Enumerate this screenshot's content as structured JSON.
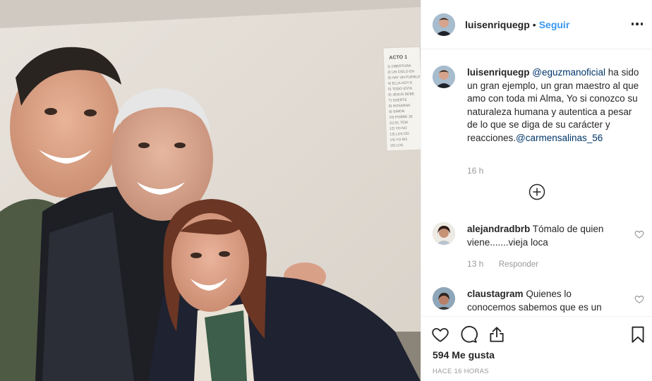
{
  "post": {
    "author": "luisenriquegp",
    "separator": "•",
    "follow_label": "Seguir"
  },
  "caption": {
    "user": "luisenriquegp",
    "mention1": "@eguzmanoficial",
    "text": " ha sido un gran ejemplo, un gran maestro al que amo con toda mi Alma, Yo si conozco su naturaleza humana y autentica a pesar de lo que se diga de su carácter y reacciones.",
    "mention2": "@carmensalinas_56",
    "time": "16 h"
  },
  "comments": [
    {
      "user": "alejandradbrb",
      "text": "Tómalo de quien viene.......vieja loca",
      "time": "13 h",
      "reply_label": "Responder"
    },
    {
      "user": "claustagram",
      "text": "Quienes lo conocemos sabemos que es un"
    }
  ],
  "footer": {
    "likes": "594 Me gusta",
    "timestamp": "HACE 16 HORAS"
  },
  "photo": {
    "wall_sign_title": "ACTO 1",
    "wall_sign_lines": [
      "1) OBERTURA",
      "2) UN CIELO EN",
      "3) HAY UN PUEBLO",
      "4) ELLA HOY E",
      "5) TODO ESTA",
      "6) JESUS DEBE",
      "7) SUERTE",
      "8) HOSANNA",
      "9) SIMON",
      "10) POBRE JE",
      "11) EL TEM",
      "12) YO NO",
      "13) LOS DO",
      "14) YO NO",
      "15) LOS"
    ]
  },
  "colors": {
    "link": "#3897f0",
    "mention": "#003569",
    "muted": "#999999",
    "text": "#262626"
  }
}
